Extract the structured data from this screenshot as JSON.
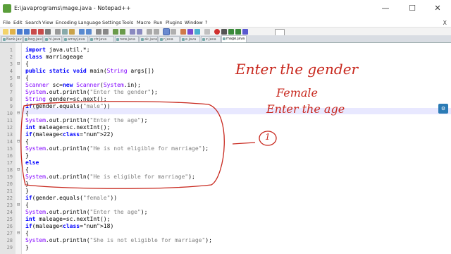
{
  "window": {
    "title": "E:\\javaprograms\\mage.java - Notepad++",
    "min": "—",
    "max": "☐",
    "close": "✕"
  },
  "menu": [
    "File",
    "Edit",
    "Search",
    "View",
    "Encoding",
    "Language",
    "Settings",
    "Tools",
    "Macro",
    "Run",
    "Plugins",
    "Window",
    "?"
  ],
  "menu_close": "X",
  "tabs": [
    "Bank.java",
    "beg.java",
    "hi.java",
    "array.java",
    "ctr.java",
    "new.java",
    "ak.java",
    "r.java",
    "e.java",
    "z.java",
    "mage.java"
  ],
  "active_tab": "mage.java",
  "code_lines": [
    {
      "n": "1",
      "t": "import java.util.*;"
    },
    {
      "n": "2",
      "t": "class marriageage"
    },
    {
      "n": "3",
      "t": "{"
    },
    {
      "n": "4",
      "t": "public static void main(String args[])"
    },
    {
      "n": "5",
      "t": "{"
    },
    {
      "n": "6",
      "t": "Scanner sc=new Scanner(System.in);"
    },
    {
      "n": "7",
      "t": "System.out.println(\"Enter the gender\");"
    },
    {
      "n": "8",
      "t": "String gender=sc.next();"
    },
    {
      "n": "9",
      "t": "if(gender.equals(\"male\"))"
    },
    {
      "n": "10",
      "t": "{"
    },
    {
      "n": "11",
      "t": "System.out.println(\"Enter the age\");"
    },
    {
      "n": "12",
      "t": "int maleage=sc.nextInt();"
    },
    {
      "n": "13",
      "t": "if(maleage<22)"
    },
    {
      "n": "14",
      "t": "{"
    },
    {
      "n": "15",
      "t": "System.out.println(\"He is not eligible for marriage\");"
    },
    {
      "n": "16",
      "t": "}"
    },
    {
      "n": "17",
      "t": "else"
    },
    {
      "n": "18",
      "t": "{"
    },
    {
      "n": "19",
      "t": "System.out.println(\"He is eligible for marriage\");"
    },
    {
      "n": "20",
      "t": "}"
    },
    {
      "n": "21",
      "t": "}"
    },
    {
      "n": "22",
      "t": "if(gender.equals(\"female\"))"
    },
    {
      "n": "23",
      "t": "{"
    },
    {
      "n": "24",
      "t": "System.out.println(\"Enter the age\");"
    },
    {
      "n": "25",
      "t": "int maleage=sc.nextInt();"
    },
    {
      "n": "26",
      "t": "if(maleage<18)"
    },
    {
      "n": "27",
      "t": "{"
    },
    {
      "n": "28",
      "t": "System.out.println(\"She is not eligible for marriage\");"
    },
    {
      "n": "29",
      "t": "}"
    }
  ],
  "annotations": {
    "line1": "Enter the gender",
    "line2": "Female",
    "line3": "Enter the age",
    "circle_num": "1"
  },
  "colors": {
    "keyword": "#0000ff",
    "type": "#8000ff",
    "string": "#808080",
    "number": "#ff8000",
    "annotation": "#c8281e",
    "current_line": "#e8e8ff"
  },
  "side_button_icon": "settings-icon"
}
